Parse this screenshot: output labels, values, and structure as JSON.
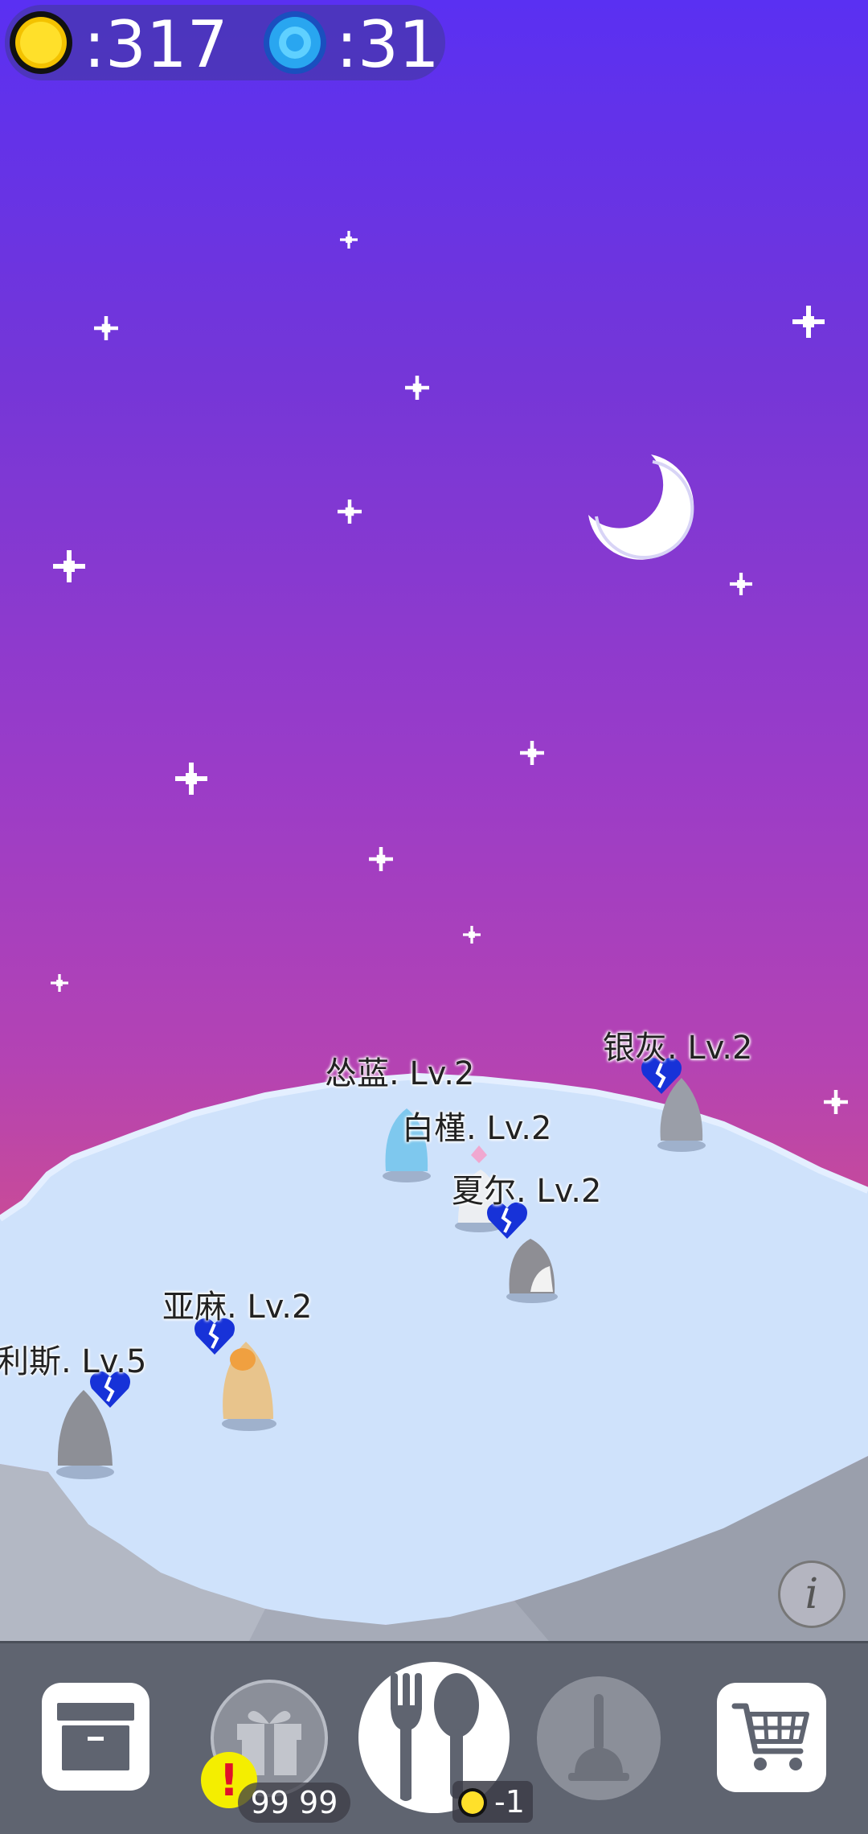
{
  "currency": {
    "coins": ":317",
    "gems": ":31",
    "coin_icon": "gold-coin-icon",
    "gem_icon": "blue-gem-icon"
  },
  "penguins": [
    {
      "name": "银灰. Lv.2",
      "mood": "broken-heart-icon",
      "color": "#9a9ea8"
    },
    {
      "name": "怂蓝. Lv.2",
      "mood": "none",
      "color": "#7ec8ee"
    },
    {
      "name": "白槿. Lv.2",
      "mood": "pink-diamond-icon",
      "color": "#e8e8ec"
    },
    {
      "name": "夏尔. Lv.2",
      "mood": "broken-heart-icon",
      "color": "#8e8e94"
    },
    {
      "name": "亚麻. Lv.2",
      "mood": "broken-heart-icon",
      "color": "#e8c48c"
    },
    {
      "name": "利斯. Lv.5",
      "mood": "broken-heart-icon",
      "color": "#8d8f96"
    }
  ],
  "info_button": {
    "icon": "info-icon",
    "label": "i"
  },
  "toolbar": {
    "buttons": [
      {
        "name": "storage-button",
        "icon": "archive-box-icon"
      },
      {
        "name": "gift-button",
        "icon": "gift-icon",
        "state": "disabled"
      },
      {
        "name": "feed-button",
        "icon": "fork-spoon-icon"
      },
      {
        "name": "clean-button",
        "icon": "plunger-icon",
        "state": "disabled"
      },
      {
        "name": "shop-button",
        "icon": "shopping-cart-icon"
      }
    ],
    "alert_badge": "!",
    "gift_count": "99 99",
    "feed_cost": "-1"
  },
  "colors": {
    "sky_top": "#5a30f2",
    "sky_bottom": "#d0569a",
    "ice": "#cfe2fb",
    "cliff": "#a6abb8",
    "toolbar": "#5f6470",
    "heart": "#1732d8"
  }
}
